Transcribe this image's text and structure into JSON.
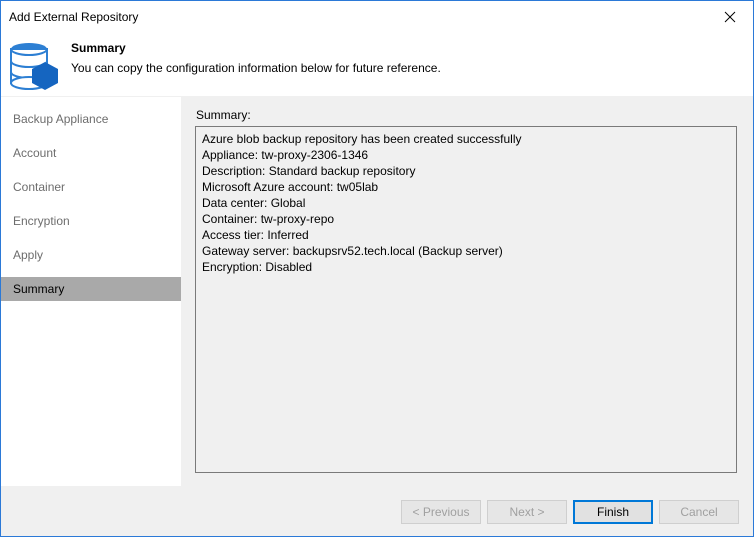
{
  "window": {
    "title": "Add External Repository"
  },
  "header": {
    "title": "Summary",
    "subtitle": "You can copy the configuration information below for future reference.",
    "icon": "database-hexagon-icon"
  },
  "sidebar": {
    "items": [
      {
        "label": "Backup Appliance",
        "active": false
      },
      {
        "label": "Account",
        "active": false
      },
      {
        "label": "Container",
        "active": false
      },
      {
        "label": "Encryption",
        "active": false
      },
      {
        "label": "Apply",
        "active": false
      },
      {
        "label": "Summary",
        "active": true
      }
    ]
  },
  "main": {
    "label": "Summary:",
    "lines": [
      "Azure blob backup repository has been created successfully",
      "Appliance: tw-proxy-2306-1346",
      "Description: Standard backup repository",
      "Microsoft Azure account: tw05lab",
      "Data center: Global",
      "Container: tw-proxy-repo",
      "Access tier: Inferred",
      "Gateway server: backupsrv52.tech.local (Backup server)",
      "Encryption: Disabled"
    ]
  },
  "footer": {
    "previous_label": "< Previous",
    "next_label": "Next >",
    "finish_label": "Finish",
    "cancel_label": "Cancel"
  },
  "colors": {
    "accent": "#0078d7",
    "icon_blue": "#1a73c7",
    "selected": "#a9a9a9"
  }
}
